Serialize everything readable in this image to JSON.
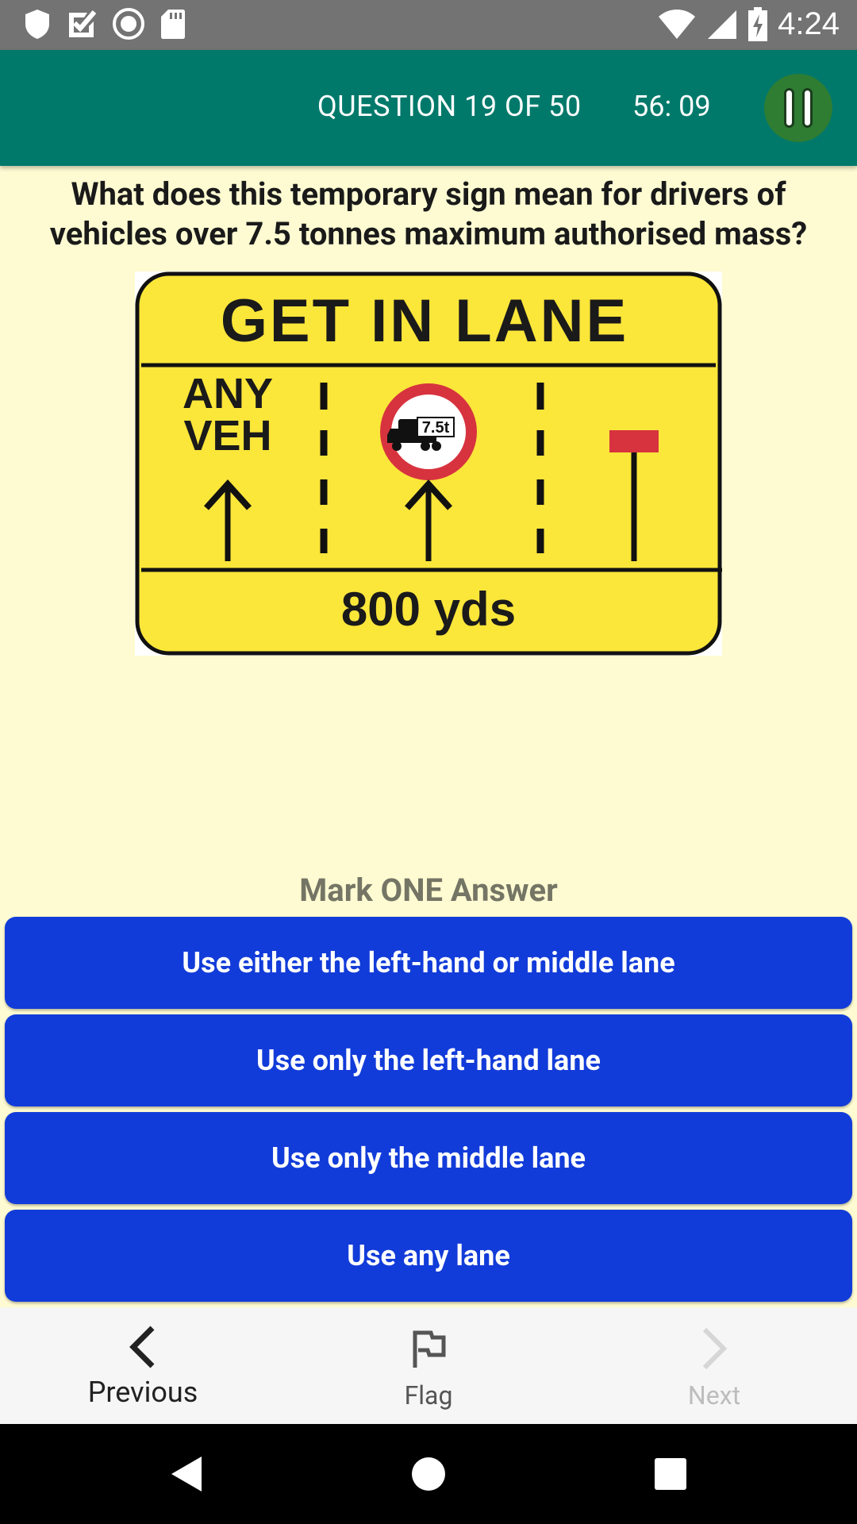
{
  "status_bar": {
    "time": "4:24",
    "icons": [
      "shield-icon",
      "check-box-icon",
      "record-icon",
      "sd-card-icon",
      "wifi-icon",
      "signal-icon",
      "battery-icon"
    ]
  },
  "header": {
    "question_counter": "QUESTION 19 OF 50",
    "timer": "56: 09",
    "pause_icon": "pause-icon"
  },
  "question": {
    "text": "What does this temporary sign mean for drivers of vehicles over 7.5 tonnes maximum authorised mass?"
  },
  "sign": {
    "title": "GET IN LANE",
    "lane1_line1": "ANY",
    "lane1_line2": "VEH",
    "weight_limit": "7.5t",
    "distance": "800 yds",
    "colors": {
      "background": "#fbe63a",
      "border": "#111111",
      "red": "#d7333f"
    }
  },
  "answers": {
    "instruction": "Mark ONE Answer",
    "options": [
      {
        "label": "Use either the left-hand or middle lane"
      },
      {
        "label": "Use only the left-hand lane"
      },
      {
        "label": "Use only the middle lane"
      },
      {
        "label": "Use any lane"
      }
    ],
    "button_color": "#123cd9"
  },
  "bottom_nav": {
    "previous": {
      "label": "Previous",
      "icon": "chevron-left-icon"
    },
    "flag": {
      "label": "Flag",
      "icon": "flag-icon"
    },
    "next": {
      "label": "Next",
      "icon": "chevron-right-icon"
    }
  },
  "system_nav": {
    "icons": [
      "back-icon",
      "home-icon",
      "recents-icon"
    ]
  }
}
